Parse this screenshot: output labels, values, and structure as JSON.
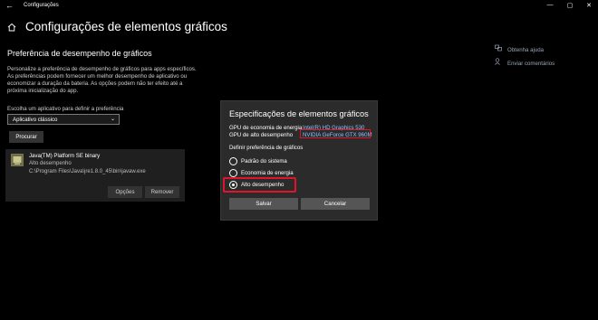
{
  "titlebar": {
    "back_glyph": "←",
    "title": "Configurações",
    "minimize_glyph": "—",
    "maximize_glyph": "▢",
    "close_glyph": "✕"
  },
  "header": {
    "icon": "home-icon",
    "title": "Configurações de elementos gráficos"
  },
  "section": {
    "title": "Preferência de desempenho de gráficos",
    "description": "Personalize a preferência de desempenho de gráficos para apps específicos. As preferências podem fornecer um melhor desempenho de aplicativo ou economizar a duração da bateria. As opções podem não ter efeito até a próxima inicialização do app.",
    "choose_label": "Escolha um aplicativo para definir a preferência",
    "select_value": "Aplicativo clássico",
    "browse_label": "Procurar"
  },
  "app_entry": {
    "name": "Java(TM) Platform SE binary",
    "preference": "Alto desempenho",
    "path": "C:\\Program Files\\Java\\jre1.8.0_45\\bin\\javaw.exe",
    "options_label": "Opções",
    "remove_label": "Remover"
  },
  "side_links": [
    {
      "icon": "help-icon",
      "label": "Obtenha ajuda"
    },
    {
      "icon": "feedback-icon",
      "label": "Enviar comentários"
    }
  ],
  "dialog": {
    "title": "Especificações de elementos gráficos",
    "power_saving_label": "GPU de economia de energia",
    "power_saving_value": "Intel(R) HD Graphics 530",
    "high_perf_label": "GPU de alto desempenho",
    "high_perf_value": "NVIDIA GeForce GTX 960M",
    "define_label": "Definir preferência de gráficos",
    "options": [
      {
        "label": "Padrão do sistema",
        "checked": false
      },
      {
        "label": "Economia de energia",
        "checked": false
      },
      {
        "label": "Alto desempenho",
        "checked": true
      }
    ],
    "save_label": "Salvar",
    "cancel_label": "Cancelar"
  },
  "colors": {
    "background": "#000000",
    "highlight": "#e0142a",
    "link": "#8ec0ff"
  }
}
